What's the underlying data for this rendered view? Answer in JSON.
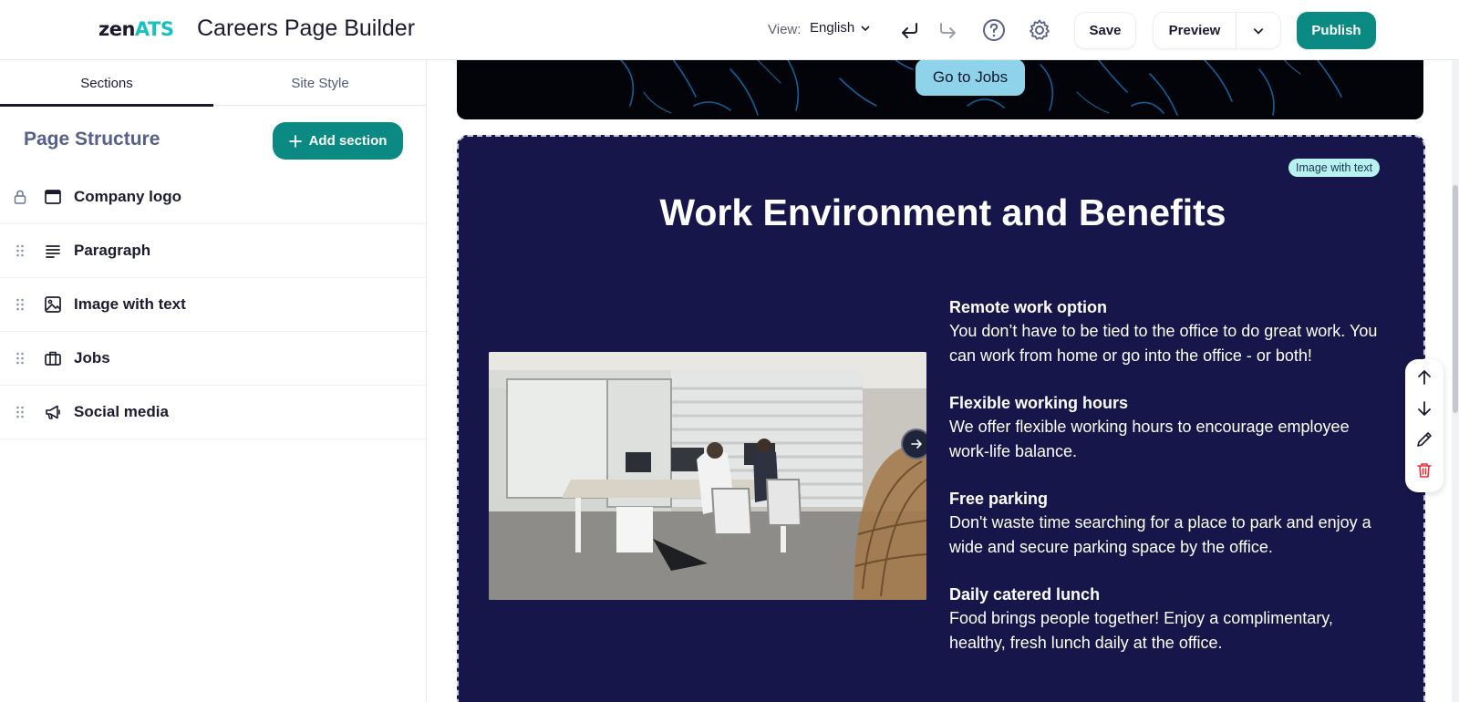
{
  "header": {
    "logo": {
      "part1": "zen",
      "part2": "ATS"
    },
    "title": "Careers Page Builder",
    "view_label": "View:",
    "language": "English",
    "icons": [
      "undo-icon",
      "redo-icon",
      "help-icon",
      "gear-icon"
    ],
    "save_label": "Save",
    "preview_label": "Preview",
    "publish_label": "Publish"
  },
  "sidebar": {
    "tabs": [
      {
        "label": "Sections",
        "active": true
      },
      {
        "label": "Site Style",
        "active": false
      }
    ],
    "structure_title": "Page Structure",
    "add_section_label": "Add section",
    "sections": [
      {
        "label": "Company logo",
        "icon": "browser-window-icon",
        "locked": true
      },
      {
        "label": "Paragraph",
        "icon": "text-lines-icon",
        "locked": false
      },
      {
        "label": "Image with text",
        "icon": "image-icon",
        "locked": false
      },
      {
        "label": "Jobs",
        "icon": "briefcase-icon",
        "locked": false
      },
      {
        "label": "Social media",
        "icon": "megaphone-icon",
        "locked": false
      }
    ]
  },
  "canvas": {
    "hero_button": "Go to Jobs",
    "section_badge": "Image with text",
    "section_title": "Work Environment and Benefits",
    "benefits": [
      {
        "title": "Remote work option",
        "text": "You don’t have to be tied to the office to do great work. You can work from home or go into the office - or both!"
      },
      {
        "title": "Flexible working hours",
        "text": "We offer flexible working hours to encourage employee work-life balance."
      },
      {
        "title": "Free parking",
        "text": "Don't waste time searching for a place to park and enjoy a wide and secure parking space by the office."
      },
      {
        "title": "Daily catered lunch",
        "text": "Food brings people together! Enjoy a complimentary, healthy, fresh lunch daily at the  office."
      }
    ],
    "toolbar_icons": [
      "arrow-up-icon",
      "arrow-down-icon",
      "pencil-icon",
      "trash-icon"
    ]
  },
  "colors": {
    "brand_teal": "#0b8a83",
    "logo_accent": "#18c0c4",
    "section_bg": "#16164a",
    "hero_button": "#8fd3ea",
    "badge_bg": "#b8f1ef",
    "delete_red": "#e0323c"
  }
}
